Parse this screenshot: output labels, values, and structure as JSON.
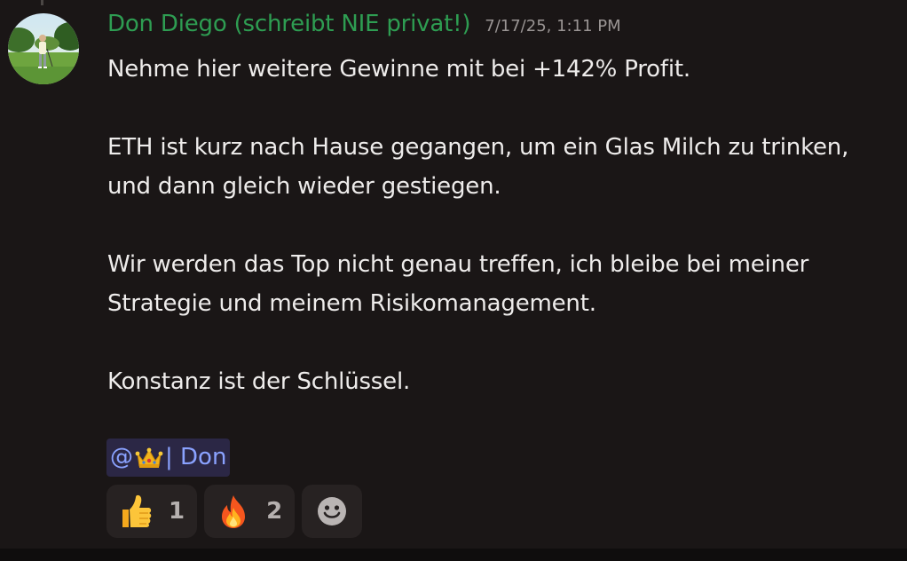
{
  "message": {
    "author": "Don Diego (schreibt NIE privat!)",
    "timestamp": "7/17/25, 1:11 PM",
    "paragraphs": [
      "Nehme hier weitere Gewinne mit bei +142% Profit.",
      "ETH ist kurz nach Hause gegangen, um ein Glas Milch zu trinken, und dann gleich wieder gestiegen.",
      "Wir werden das Top nicht genau treffen, ich bleibe bei meiner Strategie und meinem Risikomanagement.",
      "Konstanz ist der Schlüssel."
    ],
    "mention": {
      "prefix": "@",
      "emoji": "crown-icon",
      "label": " | Don"
    }
  },
  "reactions": [
    {
      "icon": "thumbs-up-icon",
      "count": "1"
    },
    {
      "icon": "fire-icon",
      "count": "2"
    }
  ],
  "add_reaction": {
    "icon": "smiley-icon"
  },
  "colors": {
    "background": "#1a1616",
    "username": "#2e9d52",
    "mention_text": "#8aa2ff",
    "mention_bg": "#2b2745",
    "reaction_bg": "#272222"
  }
}
